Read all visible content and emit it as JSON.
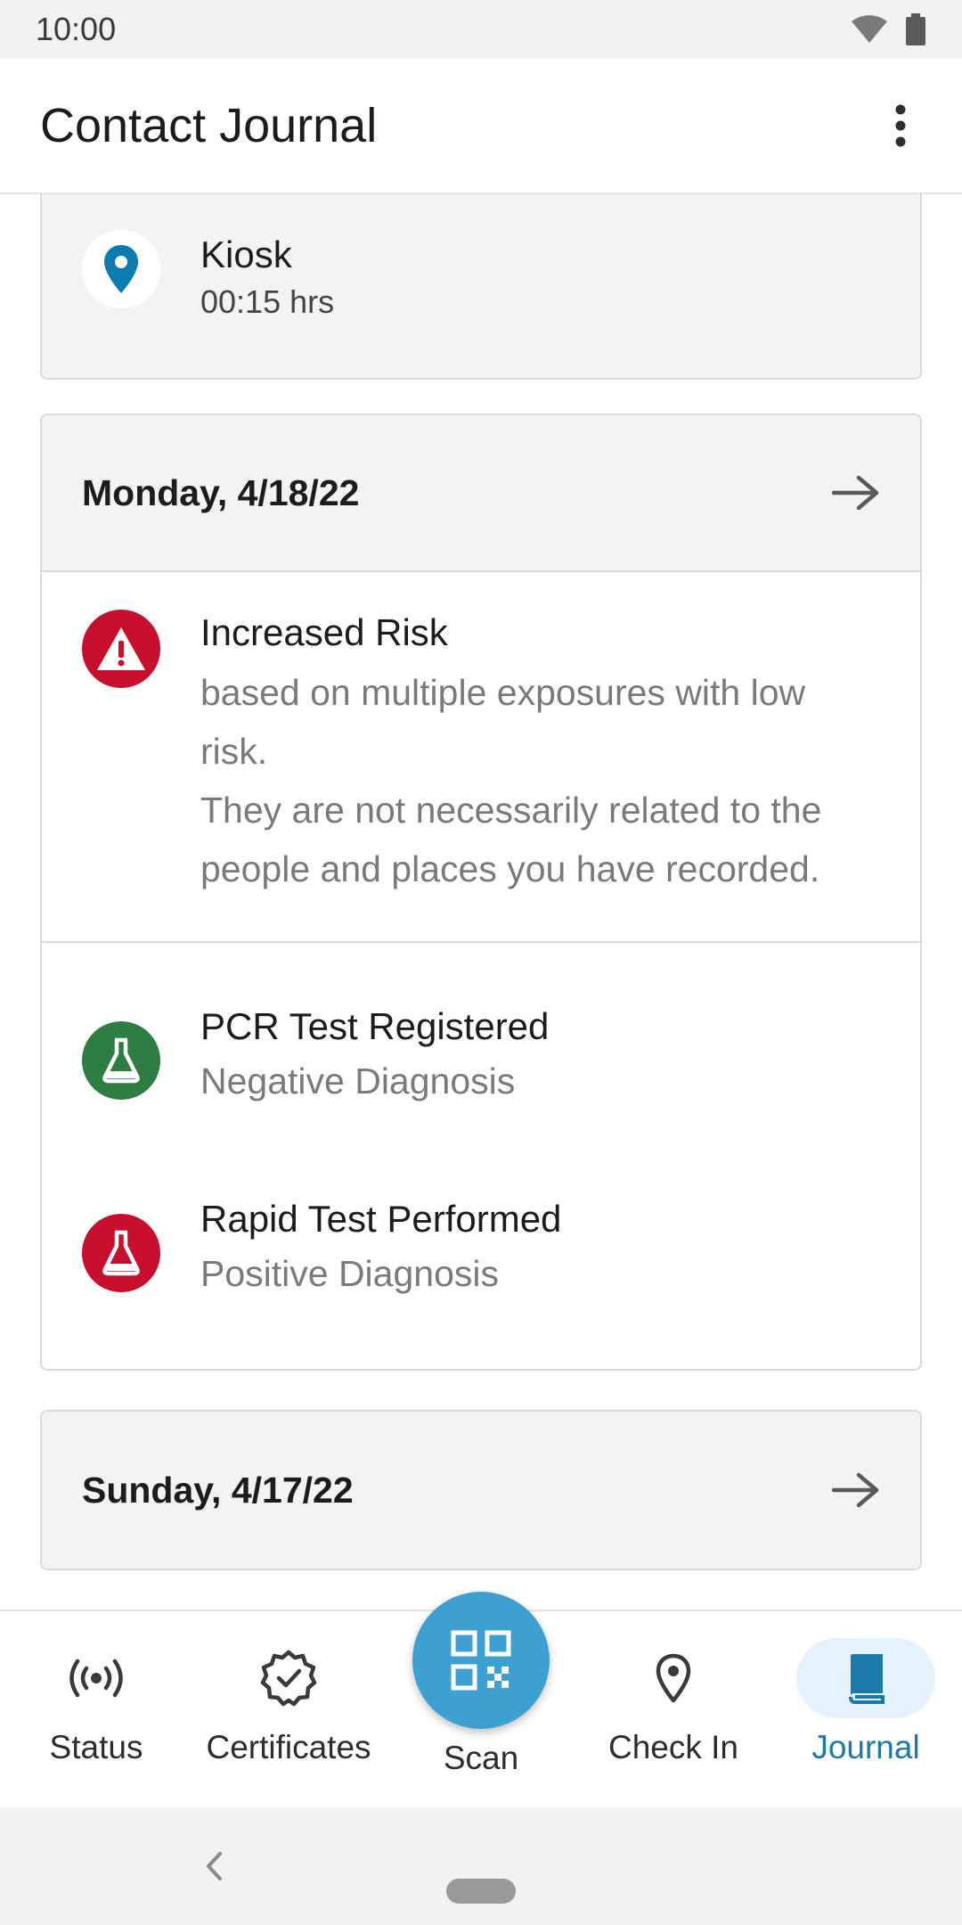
{
  "status_bar": {
    "time": "10:00"
  },
  "app_bar": {
    "title": "Contact Journal"
  },
  "partial_entry": {
    "title": "Kiosk",
    "duration": "00:15 hrs"
  },
  "day_1": {
    "date": "Monday, 4/18/22",
    "risk": {
      "title": "Increased Risk",
      "line1": "based on multiple exposures with low",
      "line2": "risk.",
      "line3": "They are not necessarily related to the",
      "line4": "people and places you have recorded."
    },
    "tests": [
      {
        "title": "PCR Test Registered",
        "result": "Negative Diagnosis",
        "color": "#2e7d42"
      },
      {
        "title": "Rapid Test Performed",
        "result": "Positive Diagnosis",
        "color": "#c8102e"
      }
    ]
  },
  "day_2": {
    "date": "Sunday, 4/17/22"
  },
  "bottom_nav": {
    "items": [
      {
        "label": "Status",
        "icon": "broadcast-icon"
      },
      {
        "label": "Certificates",
        "icon": "certificate-check-icon"
      },
      {
        "label": "Scan",
        "icon": "qr-code-icon"
      },
      {
        "label": "Check In",
        "icon": "location-pin-icon"
      },
      {
        "label": "Journal",
        "icon": "book-icon"
      }
    ],
    "active": "Journal"
  },
  "colors": {
    "accent": "#1c7aa8",
    "fab": "#3ea0d0",
    "danger": "#c8102e",
    "success": "#2e7d42",
    "pin": "#0b7bb0"
  }
}
